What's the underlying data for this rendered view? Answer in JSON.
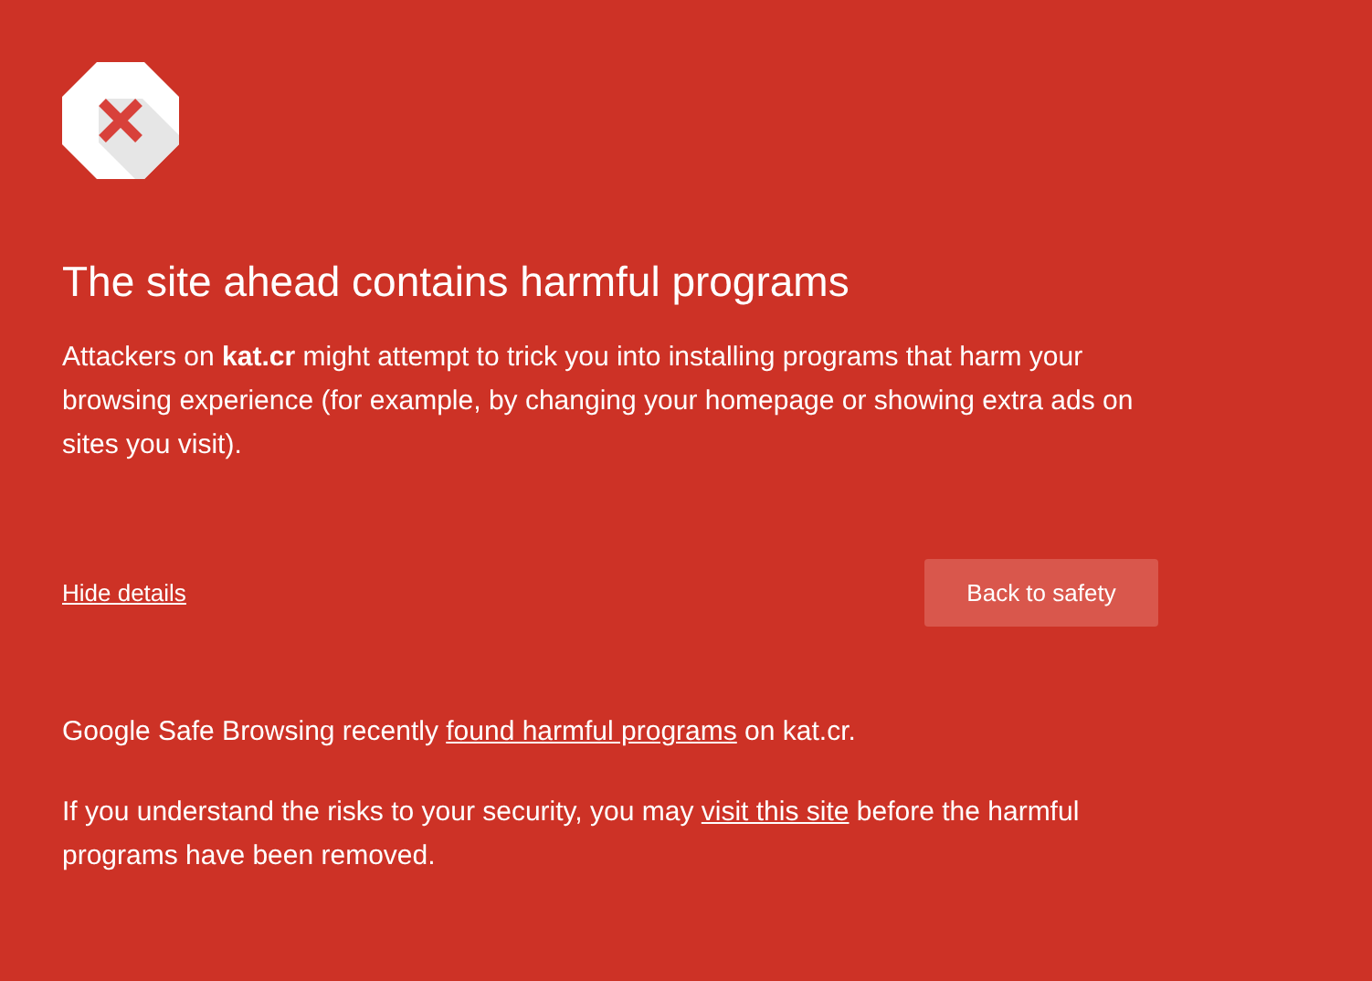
{
  "heading": "The site ahead contains harmful programs",
  "explanation": "Attackers on **kat.cr** might attempt to trick you into installing programs that harm your browsing experience (for example, by changing your homepage or showing extra ads on sites you visit).",
  "details_link": "Hide details",
  "primary_button": "Back to safety",
  "details": [
    [
      {
        "kind": "text",
        "text": "Google Safe Browsing recently "
      },
      {
        "kind": "link",
        "text": "found harmful programs"
      },
      {
        "kind": "text",
        "text": " on kat.cr."
      }
    ],
    [
      {
        "kind": "text",
        "text": "If you understand the risks to your security, you may "
      },
      {
        "kind": "link",
        "text": "visit this site"
      },
      {
        "kind": "text",
        "text": " before the harmful programs have been removed."
      }
    ]
  ]
}
